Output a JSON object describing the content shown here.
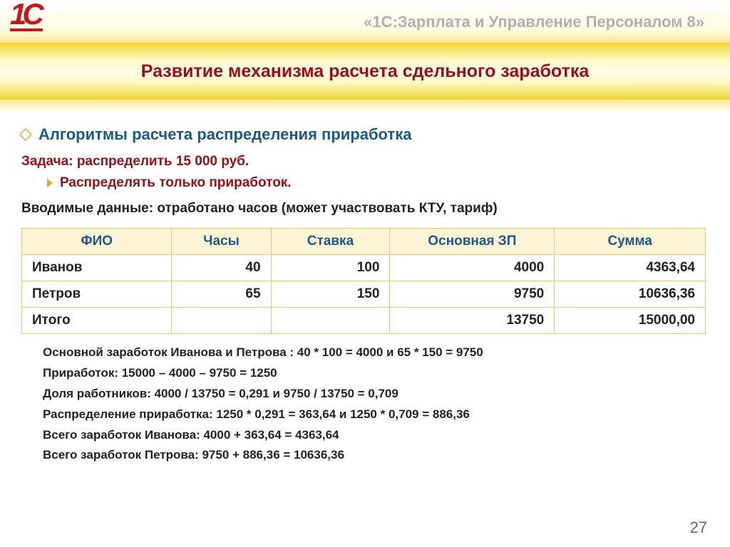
{
  "header": {
    "app_title": "«1С:Зарплата и Управление Персоналом 8»",
    "logo_text_1": "1",
    "logo_text_c": "С"
  },
  "title": "Развитие механизма расчета сдельного заработка",
  "subhead": "Алгоритмы расчета распределения приработка",
  "task": "Задача: распределить 15 000 руб.",
  "sub_bullet": "Распределять только приработок.",
  "input_data": "Вводимые данные: отработано часов (может участвовать КТУ, тариф)",
  "table": {
    "headers": [
      "ФИО",
      "Часы",
      "Ставка",
      "Основная ЗП",
      "Сумма"
    ],
    "rows": [
      {
        "name": "Иванов",
        "hours": "40",
        "rate": "100",
        "base": "4000",
        "sum": "4363,64"
      },
      {
        "name": "Петров",
        "hours": "65",
        "rate": "150",
        "base": "9750",
        "sum": "10636,36"
      },
      {
        "name": "Итого",
        "hours": "",
        "rate": "",
        "base": "13750",
        "sum": "15000,00"
      }
    ]
  },
  "calc_lines": [
    "Основной заработок Иванова и Петрова : 40 * 100 = 4000 и 65 * 150 = 9750",
    "Приработок: 15000 – 4000 – 9750 = 1250",
    "Доля работников: 4000 / 13750 = 0,291 и 9750 / 13750 = 0,709",
    "Распределение приработка: 1250 * 0,291 = 363,64 и 1250 * 0,709 = 886,36",
    "Всего заработок Иванова: 4000 + 363,64 = 4363,64",
    "Всего заработок Петрова: 9750 + 886,36 = 10636,36"
  ],
  "page_number": "27"
}
